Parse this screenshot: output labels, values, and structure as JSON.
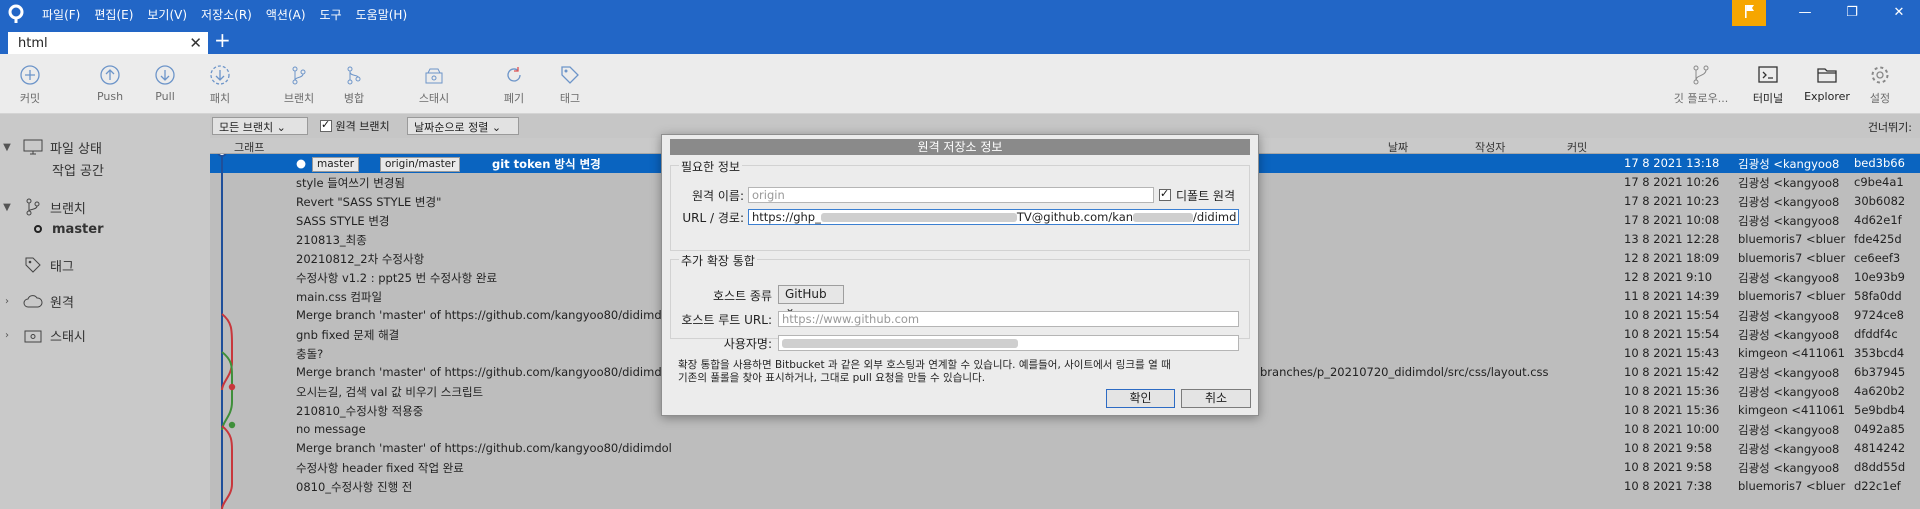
{
  "menu": [
    "파일(F)",
    "편집(E)",
    "보기(V)",
    "저장소(R)",
    "액션(A)",
    "도구",
    "도움말(H)"
  ],
  "window_controls": {
    "minimize": "—",
    "restore": "❐",
    "close": "✕"
  },
  "tab": {
    "label": "html",
    "close": "✕",
    "add": "+"
  },
  "toolbar": {
    "commit": "커밋",
    "push": "Push",
    "pull": "Pull",
    "fetch": "패치",
    "branch": "브랜치",
    "merge": "병합",
    "stash": "스태시",
    "discard": "폐기",
    "tag": "태그",
    "gitflow": "깃 플로우...",
    "terminal": "터미널",
    "explorer": "Explorer",
    "settings": "설정"
  },
  "sidebar": {
    "file_status": "파일 상태",
    "working_copy": "작업 공간",
    "branches": "브랜치",
    "master": "master",
    "tags": "태그",
    "remotes": "원격",
    "stashes": "스태시"
  },
  "filter": {
    "all_branches": "모든 브랜치 ⌄",
    "remote_branches": "원격 브랜치",
    "sort": "날짜순으로 정렬 ⌄",
    "skip": "건너뛰기:"
  },
  "table": {
    "headers": {
      "graph": "그래프",
      "date": "날짜",
      "author": "작성자",
      "commit": "커밋"
    },
    "selected_row": {
      "branch1": "master",
      "branch2": "origin/master",
      "message": "git token 방식 변경",
      "date": "17 8 2021 13:18",
      "author": "김광성 <kangyoo8",
      "hash": "bed3b66"
    },
    "rows": [
      {
        "message": "style 들여쓰기 변경됨",
        "date": "17 8 2021 10:26",
        "author": "김광성 <kangyoo8",
        "hash": "c9be4a1"
      },
      {
        "message": "Revert \"SASS STYLE 변경\"",
        "date": "17 8 2021 10:23",
        "author": "김광성 <kangyoo8",
        "hash": "30b6082"
      },
      {
        "message": "SASS STYLE 변경",
        "date": "17 8 2021 10:08",
        "author": "김광성 <kangyoo8",
        "hash": "4d62e1f"
      },
      {
        "message": "210813_최종",
        "date": "13 8 2021 12:28",
        "author": "bluemoris7 <bluer",
        "hash": "fde425d"
      },
      {
        "message": "20210812_2차 수정사항",
        "date": "12 8 2021 18:09",
        "author": "bluemoris7 <bluer",
        "hash": "ce6eef3"
      },
      {
        "message": "수정사항 v1.2 : ppt25 번 수정사항 완료",
        "date": "12 8 2021 9:10",
        "author": "김광성 <kangyoo8",
        "hash": "10e93b9"
      },
      {
        "message": "main.css 컴파일",
        "date": "11 8 2021 14:39",
        "author": "bluemoris7 <bluer",
        "hash": "58fa0dd"
      },
      {
        "message": "Merge branch 'master' of https://github.com/kangyoo80/didimdol",
        "date": "10 8 2021 15:54",
        "author": "김광성 <kangyoo8",
        "hash": "9724ce8"
      },
      {
        "message": "gnb fixed 문제 해결",
        "date": "10 8 2021 15:54",
        "author": "김광성 <kangyoo8",
        "hash": "dfddf4c"
      },
      {
        "message": "충돌?",
        "date": "10 8 2021 15:43",
        "author": "kimgeon <411061",
        "hash": "353bcd4"
      },
      {
        "message": "Merge branch 'master' of https://github.com/kangyoo80/didimdol",
        "tail": "branches/p_20210720_didimdol/src/css/layout.css",
        "date": "10 8 2021 15:42",
        "author": "김광성 <kangyoo8",
        "hash": "6b37945"
      },
      {
        "message": "오시는길, 검색 val 값 비우기 스크립트",
        "date": "10 8 2021 15:36",
        "author": "김광성 <kangyoo8",
        "hash": "4a620b2"
      },
      {
        "message": "210810_수정사항 적용중",
        "date": "10 8 2021 15:36",
        "author": "kimgeon <411061",
        "hash": "5e9bdb4"
      },
      {
        "message": "no message",
        "date": "10 8 2021 10:00",
        "author": "김광성 <kangyoo8",
        "hash": "0492a85"
      },
      {
        "message": "Merge branch 'master' of https://github.com/kangyoo80/didimdol",
        "date": "10 8 2021 9:58",
        "author": "김광성 <kangyoo8",
        "hash": "4814242"
      },
      {
        "message": "수정사항 header fixed 작업 완료",
        "date": "10 8 2021 9:58",
        "author": "김광성 <kangyoo8",
        "hash": "d8dd55d"
      },
      {
        "message": "0810_수정사항 진행 전",
        "date": "10 8 2021 7:38",
        "author": "bluemoris7 <bluer",
        "hash": "d22c1ef"
      }
    ]
  },
  "dialog": {
    "title": "원격 저장소 정보",
    "required": "필요한 정보",
    "remote_name_label": "원격 이름:",
    "remote_name_placeholder": "origin",
    "default_remote": "디폴트 원격",
    "url_label": "URL / 경로:",
    "url_prefix": "https://ghp_",
    "url_mid": "TV@github.com/kan",
    "url_suffix": "/didimd",
    "extended": "추가 확장 통합",
    "host_type_label": "호스트 종류",
    "host_type_value": "GitHub ⌄",
    "host_root_label": "호스트 루트 URL:",
    "host_root_placeholder": "https://www.github.com",
    "username_label": "사용자명:",
    "help_line1": "확장 통합을 사용하면 Bitbucket 과 같은 외부 호스팅과 연계할 수 있습니다. 예를들어, 사이트에서 링크를 열 때",
    "help_line2": "기존의 풀롤을 찾아 표시하거나, 그대로 pull 요청을 만들 수 있습니다.",
    "ok": "확인",
    "cancel": "취소"
  }
}
